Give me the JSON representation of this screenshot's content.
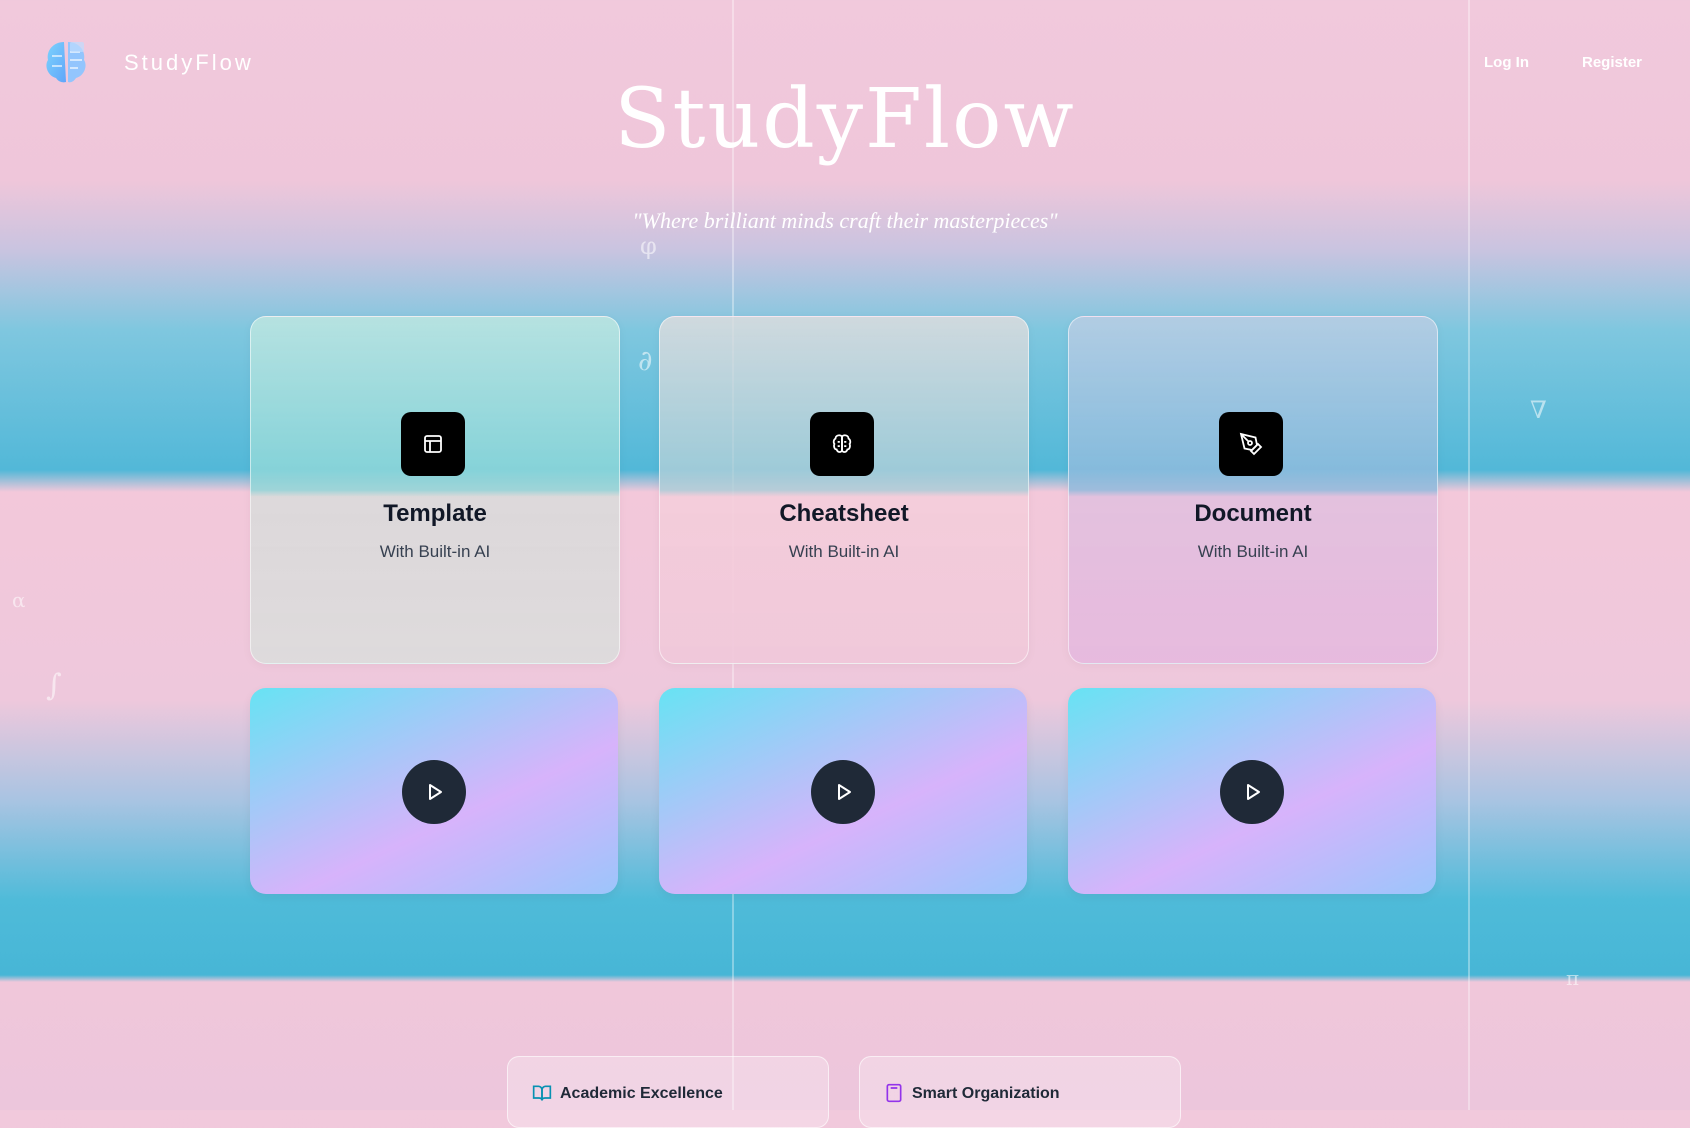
{
  "header": {
    "brand": "StudyFlow",
    "nav": {
      "login": "Log In",
      "register": "Register"
    }
  },
  "hero": {
    "title": "StudyFlow",
    "subtitle": "\"Where brilliant minds craft their masterpieces\""
  },
  "cards": [
    {
      "title": "Template",
      "subtitle": "With Built-in AI",
      "icon": "layout-icon"
    },
    {
      "title": "Cheatsheet",
      "subtitle": "With Built-in AI",
      "icon": "brain-icon"
    },
    {
      "title": "Document",
      "subtitle": "With Built-in AI",
      "icon": "pen-tool-icon"
    }
  ],
  "videos": [
    {
      "icon": "play-icon"
    },
    {
      "icon": "play-icon"
    },
    {
      "icon": "play-icon"
    }
  ],
  "features": [
    {
      "label": "Academic Excellence",
      "icon": "book-open-icon"
    },
    {
      "label": "Smart Organization",
      "icon": "calculator-icon"
    }
  ],
  "decorations": [
    "φ",
    "∂",
    "∇",
    "α",
    "∫",
    "π"
  ],
  "colors": {
    "pink": "#f1c9dc",
    "cyan": "#52b8d8",
    "dark": "#1f2937",
    "icon_black": "#000000",
    "book_icon": "#0891b2",
    "calc_icon": "#9333ea"
  }
}
